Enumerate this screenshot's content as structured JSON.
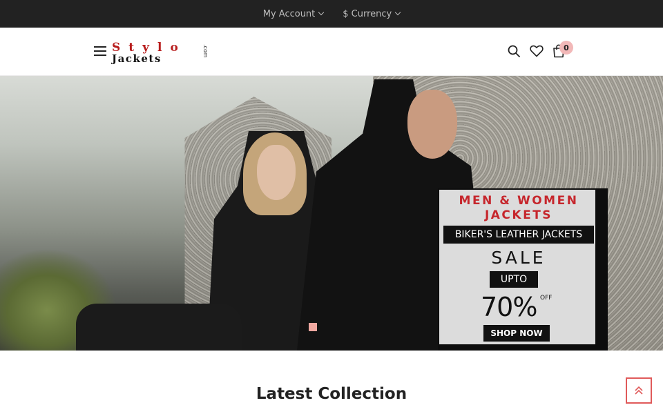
{
  "topbar": {
    "account_label": "My Account",
    "currency_label": "$ Currency"
  },
  "header": {
    "logo_line1": "Stylo",
    "logo_line2": "Jackets",
    "logo_suffix": ".com",
    "cart_count": "0",
    "icons": [
      "menu-icon",
      "search-icon",
      "heart-icon",
      "cart-icon"
    ]
  },
  "hero": {
    "banner_title": "MEN & WOMEN JACKETS",
    "banner_subtitle": "BIKER'S LEATHER JACKETS",
    "banner_sale": "SALE",
    "banner_upto": "UPTO",
    "banner_percent": "70%",
    "banner_off": "OFF",
    "banner_cta": "SHOP NOW"
  },
  "main": {
    "section_title": "Latest Collection"
  },
  "colors": {
    "topbar_bg": "#222222",
    "accent": "#e05a5a",
    "badge": "#f2b8b8",
    "banner_red": "#c6262c"
  }
}
